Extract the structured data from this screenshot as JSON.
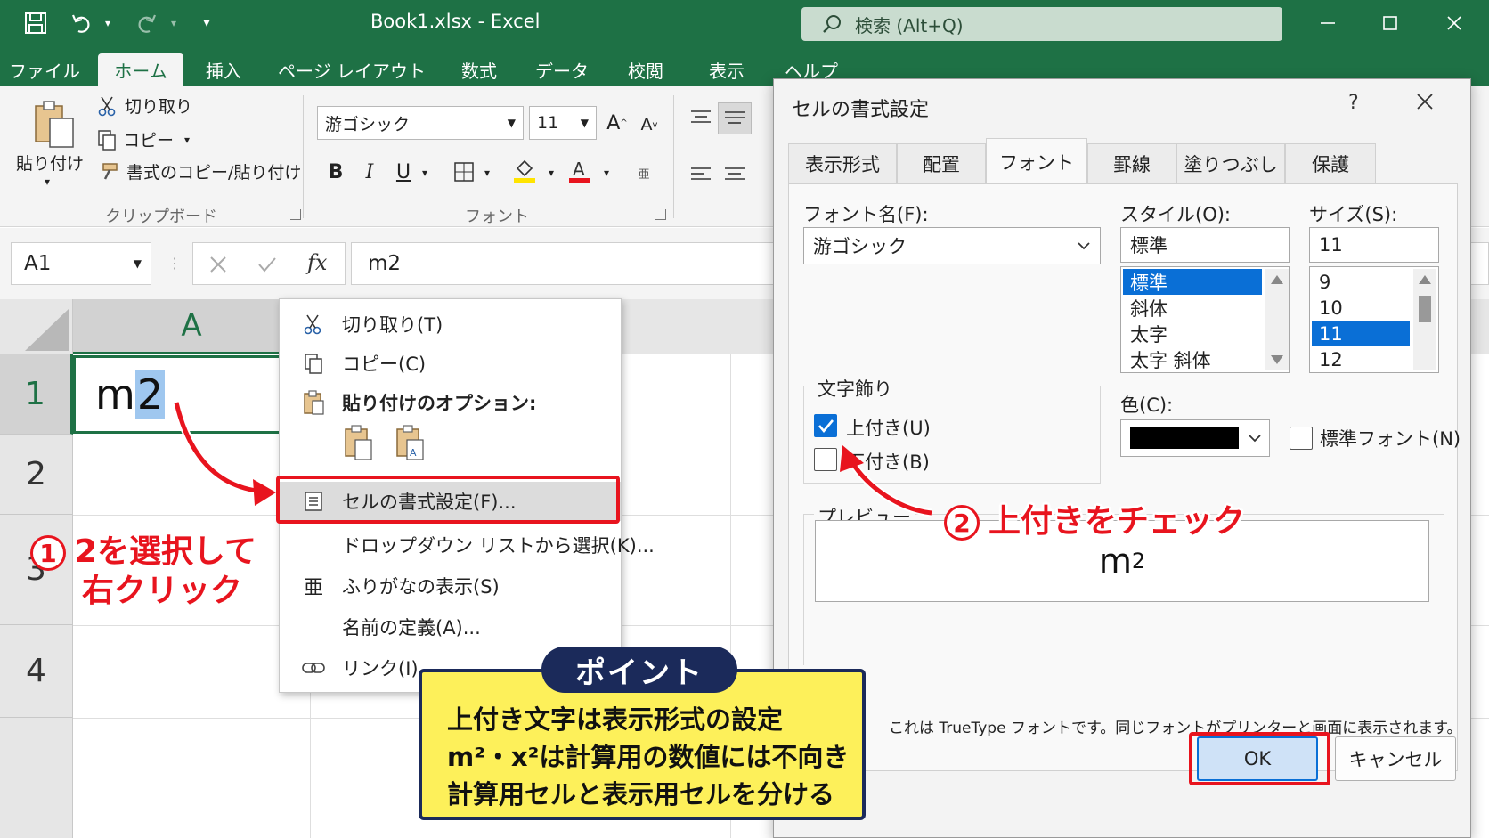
{
  "window": {
    "title": "Book1.xlsx  -  Excel",
    "search_placeholder": "検索 (Alt+Q)"
  },
  "ribbon_tabs": [
    "ファイル",
    "ホーム",
    "挿入",
    "ページ レイアウト",
    "数式",
    "データ",
    "校閲",
    "表示",
    "ヘルプ"
  ],
  "clipboard": {
    "paste": "貼り付け",
    "cut": "切り取り",
    "copy": "コピー",
    "format_painter": "書式のコピー/貼り付け",
    "group_label": "クリップボード"
  },
  "font_group": {
    "font_name": "游ゴシック",
    "font_size": "11",
    "group_label": "フォント",
    "bold": "B",
    "italic": "I",
    "underline": "U",
    "grow": "A",
    "shrink": "A"
  },
  "formula_bar": {
    "name_box": "A1",
    "fx": "fx",
    "value": "m2"
  },
  "grid": {
    "column_a": "A",
    "rows": [
      "1",
      "2",
      "3",
      "4"
    ],
    "a1_prefix": "m",
    "a1_selected": "2"
  },
  "context_menu": {
    "cut": "切り取り(T)",
    "copy": "コピー(C)",
    "paste_options": "貼り付けのオプション:",
    "format_cells": "セルの書式設定(F)...",
    "dropdown_list": "ドロップダウン リストから選択(K)...",
    "furigana": "ふりがなの表示(S)",
    "define_name": "名前の定義(A)...",
    "link": "リンク(I)"
  },
  "dialog": {
    "title": "セルの書式設定",
    "help": "?",
    "tabs": [
      "表示形式",
      "配置",
      "フォント",
      "罫線",
      "塗りつぶし",
      "保護"
    ],
    "active_tab": "フォント",
    "font_name_label": "フォント名(F):",
    "font_name_value": "游ゴシック",
    "style_label": "スタイル(O):",
    "style_value": "標準",
    "style_options": [
      "標準",
      "斜体",
      "太字",
      "太字 斜体"
    ],
    "size_label": "サイズ(S):",
    "size_value": "11",
    "size_options": [
      "9",
      "10",
      "11",
      "12"
    ],
    "effects_label": "文字飾り",
    "superscript": "上付き(U)",
    "subscript": "下付き(B)",
    "color_label": "色(C):",
    "color_value": "#000000",
    "normal_font": "標準フォント(N)",
    "preview_label": "プレビュー",
    "preview_base": "m",
    "preview_sup": "2",
    "truetype_note": "これは TrueType フォントです。同じフォントがプリンターと画面に表示されます。",
    "ok": "OK",
    "cancel": "キャンセル"
  },
  "annotations": {
    "step1_num": "1",
    "step1_line1": "2を選択して",
    "step1_line2": "右クリック",
    "step2_num": "2",
    "step2_text": "上付きをチェック",
    "point_tag": "ポイント",
    "point_lines": [
      "上付き文字は表示形式の設定",
      "m²・x²は計算用の数値には不向き",
      "計算用セルと表示用セルを分ける"
    ]
  },
  "colors": {
    "excel_green": "#1e7145",
    "annotation_red": "#e8141e",
    "point_yellow": "#fdf05a",
    "point_navy": "#1b2a5a",
    "select_blue": "#0a6fd6"
  }
}
